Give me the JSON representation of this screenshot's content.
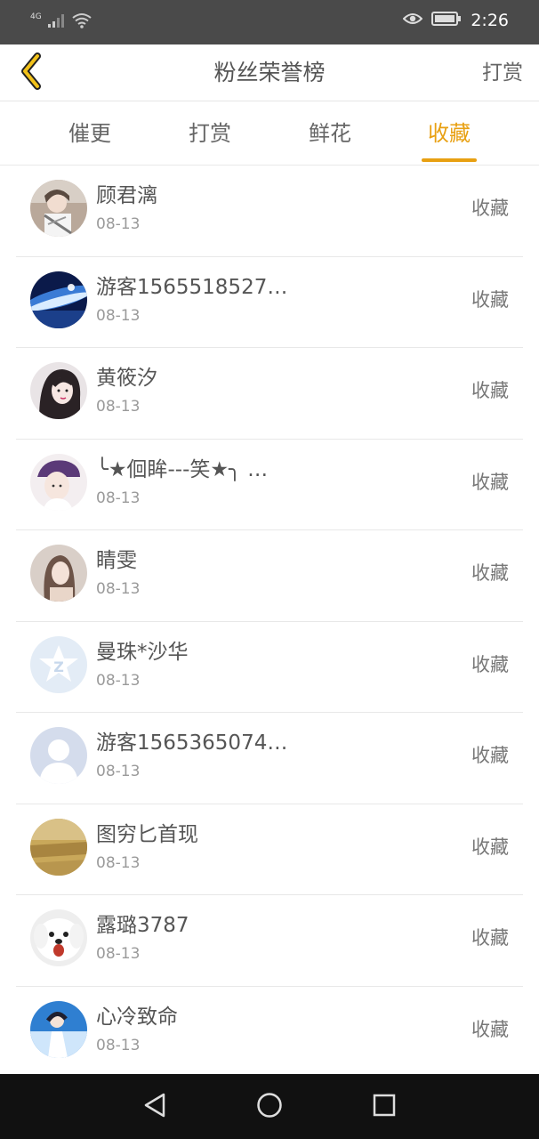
{
  "status_bar": {
    "network": "4G",
    "time": "2:26"
  },
  "header": {
    "title": "粉丝荣誉榜",
    "action": "打赏"
  },
  "tabs": [
    {
      "label": "催更",
      "active": false
    },
    {
      "label": "打赏",
      "active": false
    },
    {
      "label": "鲜花",
      "active": false
    },
    {
      "label": "收藏",
      "active": true
    }
  ],
  "list": {
    "items": [
      {
        "name": "顾君漓",
        "date": "08-13",
        "action": "收藏",
        "avatar": "avatar-photo"
      },
      {
        "name": "游客1565518527…",
        "date": "08-13",
        "action": "收藏",
        "avatar": "avatar-photo"
      },
      {
        "name": "黄筱汐",
        "date": "08-13",
        "action": "收藏",
        "avatar": "avatar-photo"
      },
      {
        "name": "╰★佪眸---笑★╮ …",
        "date": "08-13",
        "action": "收藏",
        "avatar": "avatar-photo"
      },
      {
        "name": "睛雯",
        "date": "08-13",
        "action": "收藏",
        "avatar": "avatar-photo"
      },
      {
        "name": "曼珠*沙华",
        "date": "08-13",
        "action": "收藏",
        "avatar": "qq-logo-avatar"
      },
      {
        "name": "游客1565365074…",
        "date": "08-13",
        "action": "收藏",
        "avatar": "default-user-avatar"
      },
      {
        "name": "图穷匕首现",
        "date": "08-13",
        "action": "收藏",
        "avatar": "avatar-photo"
      },
      {
        "name": "露璐3787",
        "date": "08-13",
        "action": "收藏",
        "avatar": "avatar-photo"
      },
      {
        "name": "心冷致命",
        "date": "08-13",
        "action": "收藏",
        "avatar": "avatar-photo"
      }
    ]
  },
  "colors": {
    "accent": "#e8a012",
    "status_bar_bg": "#4a4a4a",
    "nav_bar_bg": "#111111",
    "text_primary": "#555555",
    "text_secondary": "#9a9a9a"
  }
}
